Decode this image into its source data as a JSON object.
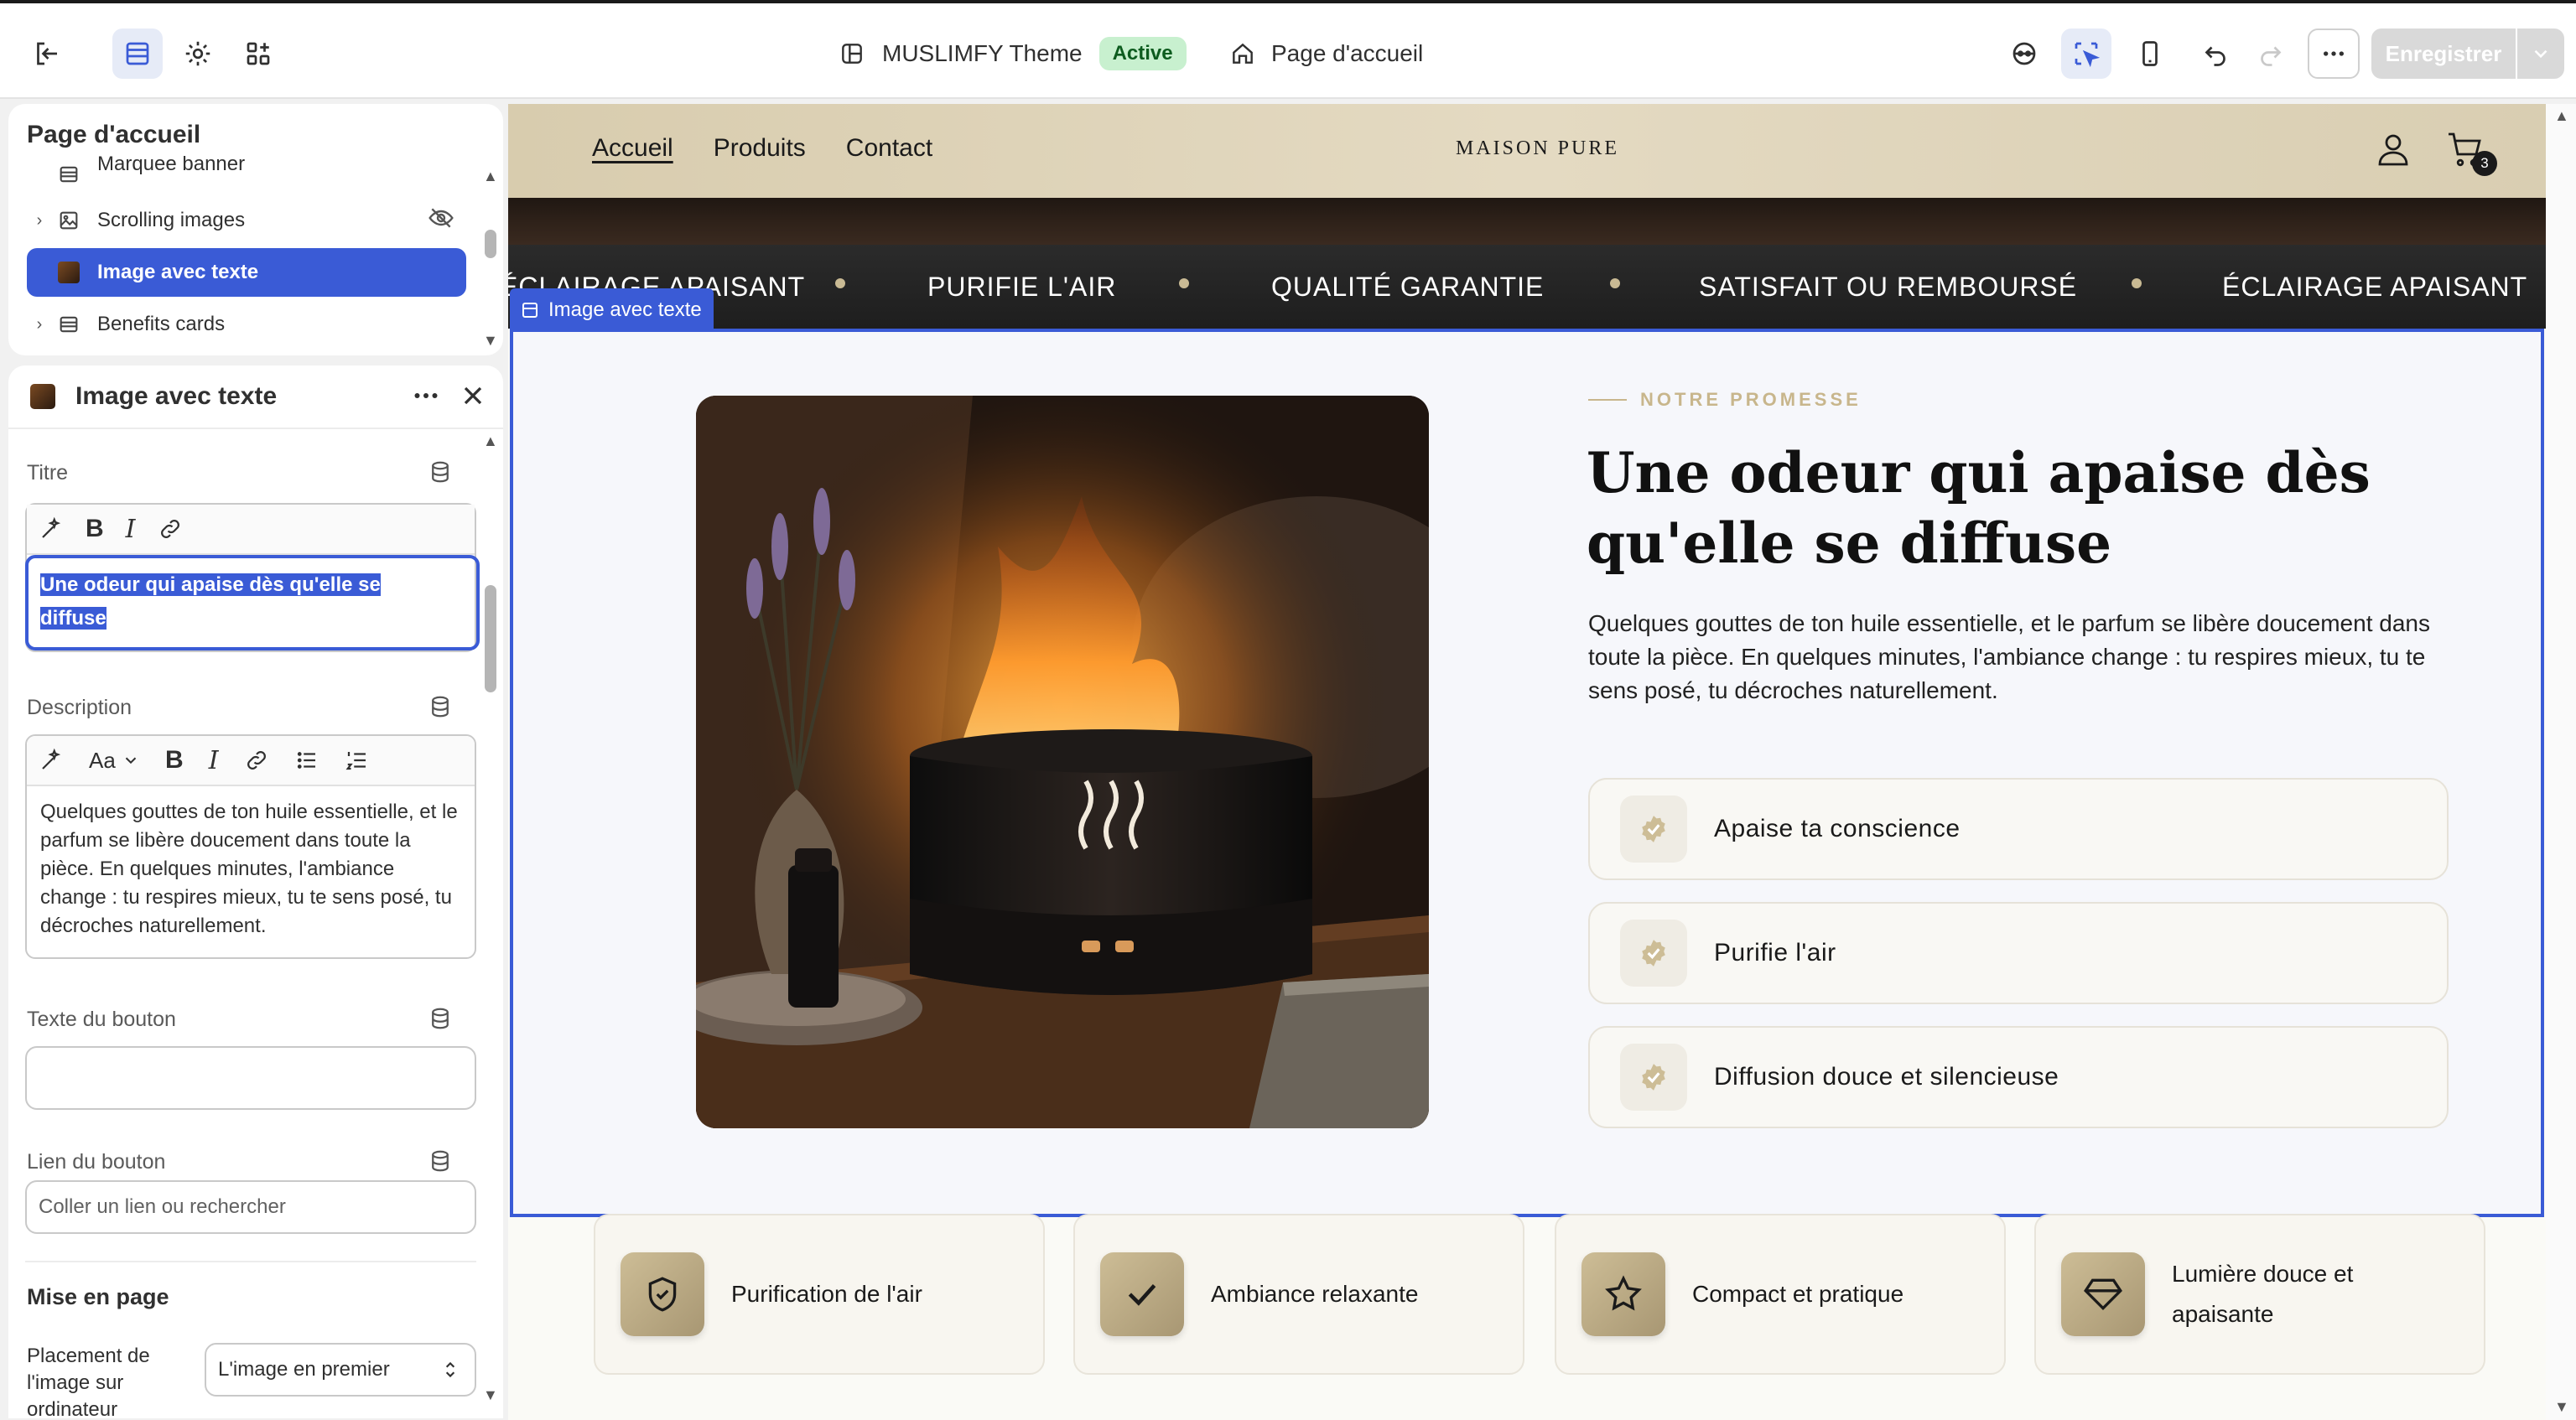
{
  "topbar": {
    "theme_name": "MUSLIMFY Theme",
    "theme_status": "Active",
    "page_name": "Page d'accueil",
    "save_label": "Enregistrer"
  },
  "sections_panel": {
    "title": "Page d'accueil",
    "items": [
      {
        "label": "Marquee banner"
      },
      {
        "label": "Scrolling images"
      },
      {
        "label": "Image avec texte"
      },
      {
        "label": "Benefits cards"
      }
    ]
  },
  "settings_panel": {
    "title": "Image avec texte",
    "title_label": "Titre",
    "title_value": "Une odeur qui apaise dès qu'elle se diffuse",
    "title_line1": "Une odeur qui apaise dès qu'elle se",
    "title_line2": "diffuse",
    "description_label": "Description",
    "description_value": "Quelques gouttes de ton huile essentielle, et le parfum se libère doucement dans toute la pièce. En quelques minutes, l'ambiance change : tu respires mieux, tu te sens posé, tu décroches naturellement.",
    "button_text_label": "Texte du bouton",
    "button_text_value": "",
    "button_link_label": "Lien du bouton",
    "button_link_placeholder": "Coller un lien ou rechercher",
    "layout_heading": "Mise en page",
    "placement_label": "Placement de l'image sur ordinateur",
    "placement_value": "L'image en premier"
  },
  "storefront": {
    "nav": [
      "Accueil",
      "Produits",
      "Contact"
    ],
    "brand": "MAISON PURE",
    "cart_count": "3",
    "marquee": [
      "ÉCLAIRAGE APAISANT",
      "PURIFIE L'AIR",
      "QUALITÉ GARANTIE",
      "SATISFAIT OU REMBOURSÉ",
      "ÉCLAIRAGE APAISANT"
    ],
    "section_tag": "Image avec texte",
    "eyebrow": "NOTRE PROMESSE",
    "heading": "Une odeur qui apaise dès qu'elle se diffuse",
    "description": "Quelques gouttes de ton huile essentielle, et le parfum se libère doucement dans toute la pièce. En quelques minutes, l'ambiance change : tu respires mieux, tu te sens posé, tu décroches naturellement.",
    "benefits": [
      "Apaise ta conscience",
      "Purifie l'air",
      "Diffusion douce et silencieuse"
    ],
    "cards": [
      {
        "label": "Purification de l'air",
        "icon": "shield-check-icon"
      },
      {
        "label": "Ambiance relaxante",
        "icon": "checkmark-icon"
      },
      {
        "label": "Compact et pratique",
        "icon": "star-icon"
      },
      {
        "label": "Lumière douce et apaisante",
        "icon": "diamond-icon"
      }
    ]
  },
  "colors": {
    "accent": "#3a5bd6",
    "gold": "#c8b68c",
    "status_green": "#c8f0cf"
  }
}
